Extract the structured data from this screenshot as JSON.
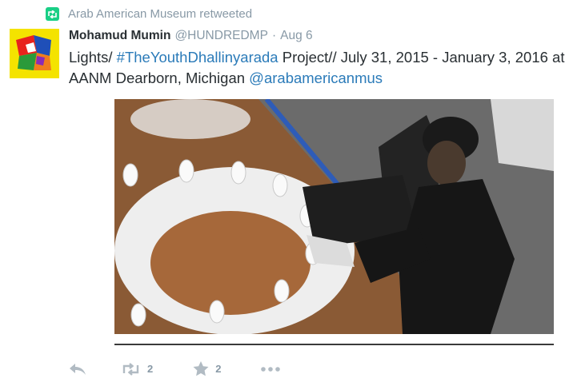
{
  "retweet_context": {
    "icon": "retweet-icon",
    "text": "Arab American Museum retweeted",
    "color": "#19cf86"
  },
  "tweet": {
    "author_name": "Mohamud Mumin",
    "author_handle": "@HUNDREDMP",
    "separator": "·",
    "timestamp": "Aug 6",
    "text_part1": "Lights/ ",
    "hashtag": "#TheYouthDhallinyarada",
    "text_part2": " Project// July 31, 2015 - January 3, 2016 at AANM Dearborn, Michigan ",
    "mention": "@arabamericanmus",
    "link_color": "#2b7bb9"
  },
  "actions": {
    "reply": {
      "icon": "reply-icon"
    },
    "retweet": {
      "icon": "retweet-icon",
      "count": "2"
    },
    "favorite": {
      "icon": "star-icon",
      "count": "2"
    },
    "more": {
      "icon": "more-dots-icon"
    }
  }
}
